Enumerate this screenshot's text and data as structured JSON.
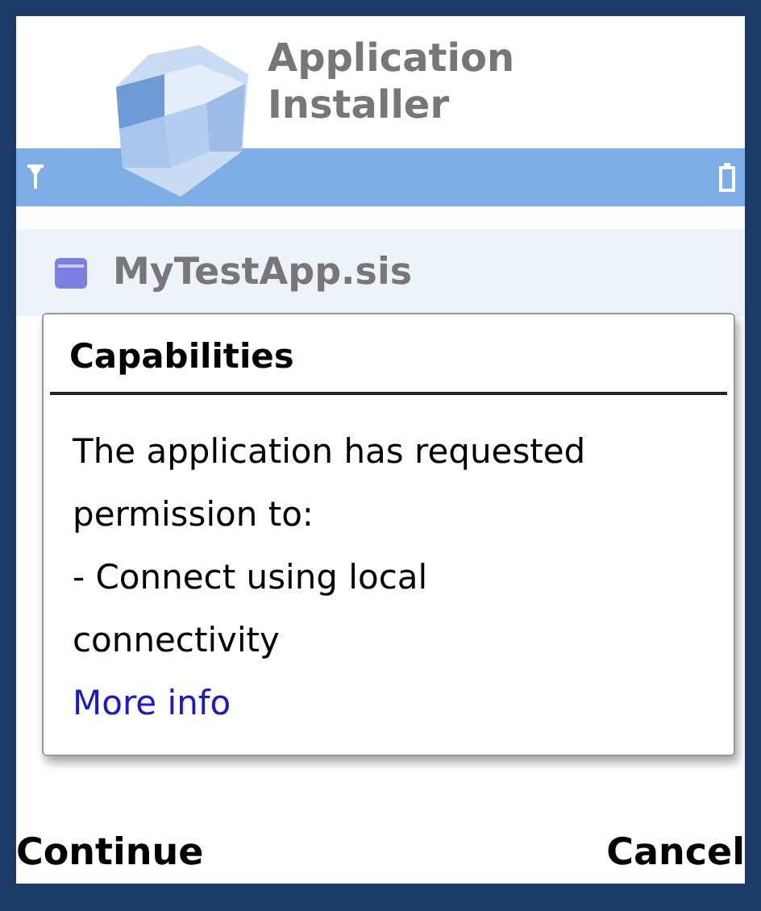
{
  "header": {
    "title": "Application Installer"
  },
  "list": [
    {
      "label": "MyTestApp.sis",
      "selected": true
    }
  ],
  "dialog": {
    "title": "Capabilities",
    "paragraphs": [
      "The application has requested permission to:",
      "- Connect using local connectivity"
    ],
    "link": "More info"
  },
  "softkeys": {
    "left": "Continue",
    "right": "Cancel"
  }
}
